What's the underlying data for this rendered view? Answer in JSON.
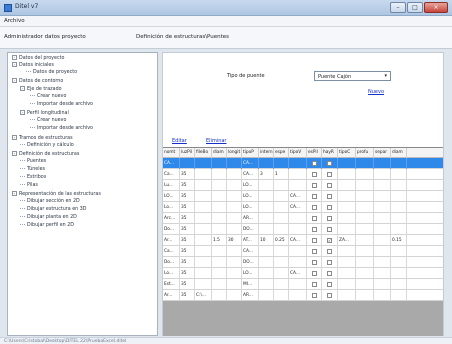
{
  "window": {
    "title": "Ditel v7"
  },
  "menu": {
    "items": [
      "Archivo"
    ]
  },
  "tabs": {
    "breadcrumb1": "Administrador datos proyecto",
    "breadcrumb2": "Definición de estructuras\\Puentes"
  },
  "tree": {
    "items": [
      {
        "label": "Datos del proyecto",
        "toggle": "-"
      },
      {
        "label": "Datos iniciales",
        "toggle": "-"
      },
      {
        "label": "Datos de proyecto",
        "toggle": ""
      },
      {
        "label": "Datos de contorno",
        "toggle": "-"
      },
      {
        "label": "Eje de trazado",
        "toggle": "-"
      },
      {
        "label": "Crear nuevo",
        "toggle": ""
      },
      {
        "label": "Importar desde archivo",
        "toggle": ""
      },
      {
        "label": "Perfil longitudinal",
        "toggle": "-"
      },
      {
        "label": "Crear nuevo",
        "toggle": ""
      },
      {
        "label": "Importar desde archivo",
        "toggle": ""
      },
      {
        "label": "Tramos de estructuras",
        "toggle": "-"
      },
      {
        "label": "Definición y cálculo",
        "toggle": ""
      },
      {
        "label": "Definición de estructuras",
        "toggle": "-"
      },
      {
        "label": "Puentes",
        "toggle": ""
      },
      {
        "label": "Túneles",
        "toggle": ""
      },
      {
        "label": "Estribos",
        "toggle": ""
      },
      {
        "label": "Pilas",
        "toggle": ""
      },
      {
        "label": "Representación de las estructuras",
        "toggle": "-"
      },
      {
        "label": "Dibujar sección en 2D",
        "toggle": ""
      },
      {
        "label": "Dibujar estructura en 3D",
        "toggle": ""
      },
      {
        "label": "Dibujar planta en 2D",
        "toggle": ""
      },
      {
        "label": "Dibujar perfil en 2D",
        "toggle": ""
      }
    ]
  },
  "form": {
    "tipo_label": "Tipo de puente",
    "tipo_value": "Puente Cajón",
    "tipo_arrow": "▾",
    "nuevo": "Nuevo",
    "editar": "Editar",
    "eliminar": "Eliminar"
  },
  "grid": {
    "columns": [
      "nomt",
      "luzPil",
      "fileBo",
      "diam",
      "longit",
      "tipoP",
      "intern",
      "espe",
      "tipoV",
      "esPil",
      "hayR",
      "tipoC",
      "profu",
      "separ",
      "diam"
    ],
    "rows": [
      {
        "cells": [
          "CA...",
          "",
          "",
          "",
          "",
          "CA...",
          "",
          "",
          "",
          "",
          "",
          "",
          "",
          "",
          ""
        ],
        "chk1": "",
        "chk2": "",
        "selected": true
      },
      {
        "cells": [
          "Ca...",
          "35",
          "",
          "",
          "",
          "CA...",
          "3",
          "1",
          "",
          "",
          "",
          "",
          "",
          "",
          ""
        ],
        "chk1": "",
        "chk2": "",
        "selected": false
      },
      {
        "cells": [
          "Lu...",
          "35",
          "",
          "",
          "",
          "LO...",
          "",
          "",
          "",
          "",
          "",
          "",
          "",
          "",
          ""
        ],
        "chk1": "",
        "chk2": "",
        "selected": false
      },
      {
        "cells": [
          "LO...",
          "35",
          "",
          "",
          "",
          "LO...",
          "",
          "",
          "CA...",
          "",
          "",
          "",
          "",
          "",
          ""
        ],
        "chk1": "",
        "chk2": "",
        "selected": false
      },
      {
        "cells": [
          "Lo...",
          "35",
          "",
          "",
          "",
          "LO...",
          "",
          "",
          "CA...",
          "",
          "",
          "",
          "",
          "",
          ""
        ],
        "chk1": "",
        "chk2": "",
        "selected": false
      },
      {
        "cells": [
          "Arc...",
          "35",
          "",
          "",
          "",
          "AR...",
          "",
          "",
          "",
          "",
          "",
          "",
          "",
          "",
          ""
        ],
        "chk1": "",
        "chk2": "",
        "selected": false
      },
      {
        "cells": [
          "Do...",
          "35",
          "",
          "",
          "",
          "DO...",
          "",
          "",
          "",
          "",
          "",
          "",
          "",
          "",
          ""
        ],
        "chk1": "",
        "chk2": "",
        "selected": false
      },
      {
        "cells": [
          "Ar...",
          "35",
          "",
          "1.5",
          "30",
          "AT...",
          "10",
          "0.25",
          "CA...",
          "",
          "",
          "ZA...",
          "",
          "",
          "0.15"
        ],
        "chk1": "",
        "chk2": "✓",
        "selected": false
      },
      {
        "cells": [
          "Ca...",
          "35",
          "",
          "",
          "",
          "CA...",
          "",
          "",
          "",
          "",
          "",
          "",
          "",
          "",
          ""
        ],
        "chk1": "",
        "chk2": "",
        "selected": false
      },
      {
        "cells": [
          "Do...",
          "35",
          "",
          "",
          "",
          "DO...",
          "",
          "",
          "",
          "",
          "",
          "",
          "",
          "",
          ""
        ],
        "chk1": "",
        "chk2": "",
        "selected": false
      },
      {
        "cells": [
          "Lo...",
          "35",
          "",
          "",
          "",
          "LO...",
          "",
          "",
          "CA...",
          "",
          "",
          "",
          "",
          "",
          ""
        ],
        "chk1": "",
        "chk2": "",
        "selected": false
      },
      {
        "cells": [
          "Est...",
          "35",
          "",
          "",
          "",
          "MI...",
          "",
          "",
          "",
          "",
          "",
          "",
          "",
          "",
          ""
        ],
        "chk1": "",
        "chk2": "",
        "selected": false
      },
      {
        "cells": [
          "Ar...",
          "35",
          "C:\\...",
          "",
          "",
          "AR...",
          "",
          "",
          "",
          "",
          "",
          "",
          "",
          "",
          ""
        ],
        "chk1": "",
        "chk2": "",
        "selected": false
      }
    ]
  },
  "status": {
    "path": "C:\\Users\\Cristobal\\Desktop\\DITEL 22\\PruebaExcel.ditel"
  }
}
